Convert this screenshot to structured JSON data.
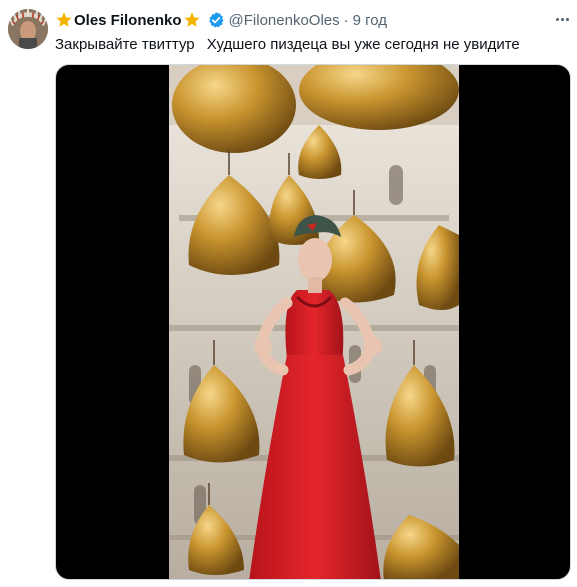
{
  "tweet": {
    "author_name": "Oles Filonenko",
    "handle": "@FilonenkoOles",
    "separator": "·",
    "time": "9 год",
    "text_parts": [
      "Закрывайте твиттур",
      "Худшего пиздеца вы уже сегодня не увидите"
    ],
    "verified": true,
    "star_color": "#f5b301",
    "verified_color": "#1d9bf0"
  },
  "icons": {
    "more": "more-icon",
    "verified": "verified-badge-icon",
    "star": "star-icon"
  },
  "media": {
    "type": "video",
    "background_color": "#000000",
    "scene": "woman in red dress and green cap in front of golden domes"
  }
}
